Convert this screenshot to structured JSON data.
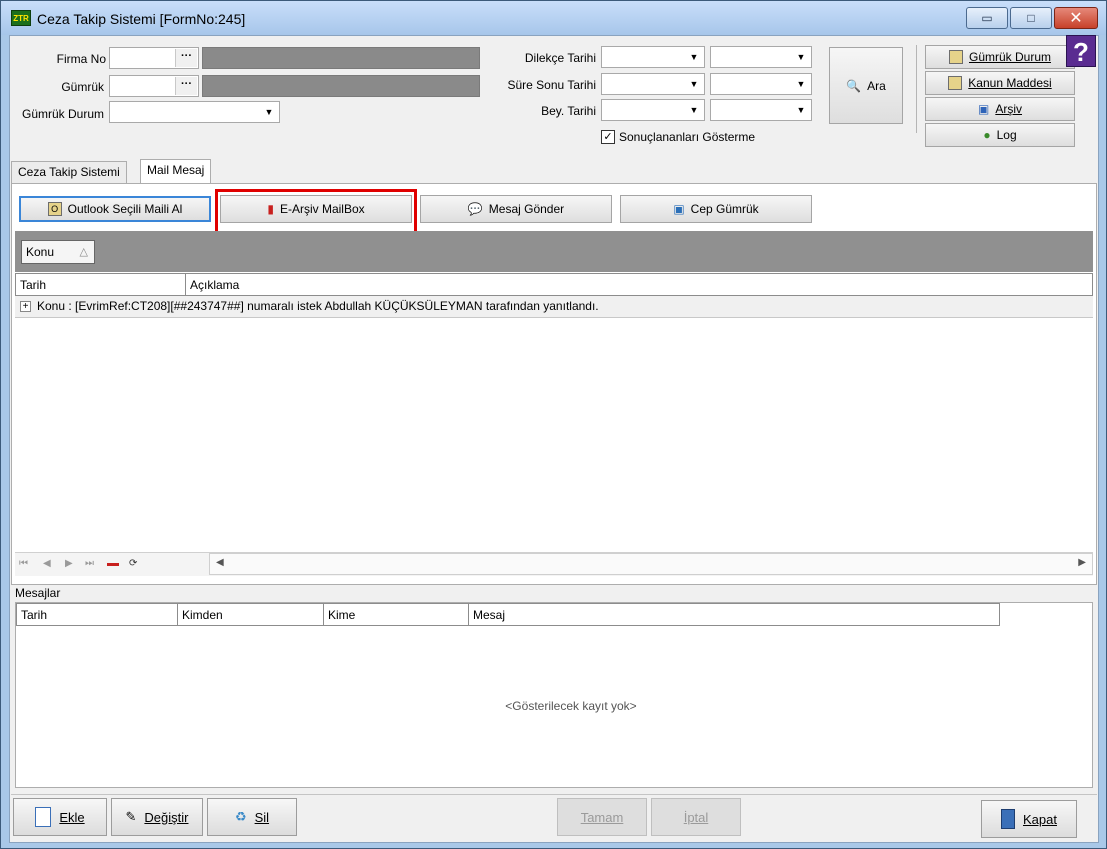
{
  "window": {
    "app_icon_text": "ZTR",
    "title": "Ceza Takip Sistemi [FormNo:245]",
    "min_symbol": "▭",
    "max_symbol": "□",
    "close_symbol": "✕"
  },
  "filters": {
    "firma_no_label": "Firma No",
    "gumruk_label": "Gümrük",
    "gumruk_durum_label": "Gümrük Durum",
    "dilekce_label": "Dilekçe Tarihi",
    "sure_sonu_label": "Süre Sonu Tarihi",
    "bey_label": "Bey. Tarihi",
    "ellipsis": "···",
    "dropdown_arrow": "▼",
    "hide_results_label": "Sonuçlananları Gösterme",
    "hide_results_checked": "✓",
    "search_label": "Ara"
  },
  "side_buttons": {
    "gumruk_durum": "Gümrük Durum",
    "kanun_maddesi": "Kanun Maddesi",
    "arsiv": "Arşiv",
    "log": "Log",
    "help": "?"
  },
  "tabs": [
    {
      "label": "Ceza Takip Sistemi"
    },
    {
      "label": "Mail Mesaj"
    }
  ],
  "toolbar": {
    "outlook": "Outlook Seçili Maili Al",
    "earsiv": "E-Arşiv MailBox",
    "mesaj_gonder": "Mesaj Gönder",
    "cep_gumruk": "Cep Gümrük"
  },
  "grid": {
    "group_column": "Konu",
    "group_sort": "△",
    "columns": [
      "Tarih",
      "Açıklama"
    ],
    "expand_symbol": "+",
    "rows": [
      {
        "text": "Konu : [EvrimRef:CT208][##243747##] numaralı istek  Abdullah KÜÇÜKSÜLEYMAN tarafından yanıtlandı."
      }
    ],
    "nav": [
      "⏮",
      "◀",
      "▶",
      "⏭"
    ],
    "scroll_left": "◀",
    "scroll_right": "▶"
  },
  "messages": {
    "label": "Mesajlar",
    "columns": [
      "Tarih",
      "Kimden",
      "Kime",
      "Mesaj"
    ],
    "empty": "<Gösterilecek kayıt yok>"
  },
  "bottom": {
    "ekle": "Ekle",
    "degistir": "Değiştir",
    "sil": "Sil",
    "tamam": "Tamam",
    "iptal": "İptal",
    "kapat": "Kapat"
  }
}
